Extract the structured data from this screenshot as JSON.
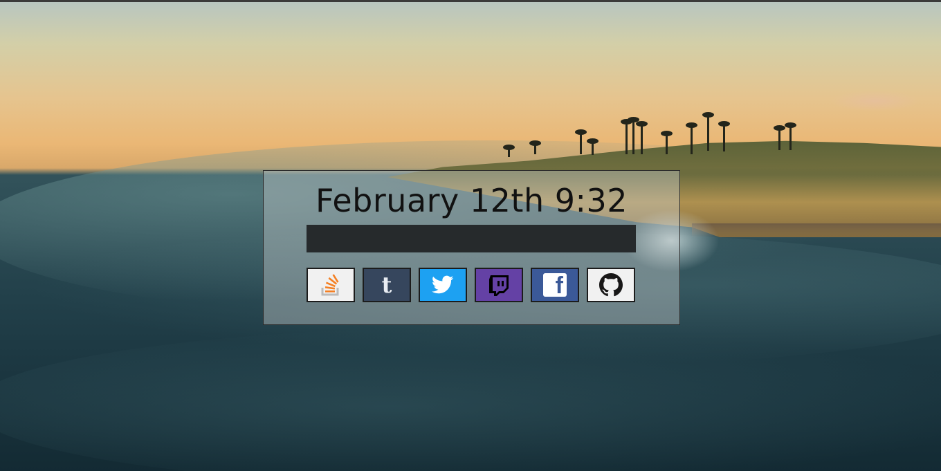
{
  "clock": {
    "text": "February 12th 9:32"
  },
  "search": {
    "value": "",
    "placeholder": ""
  },
  "links": [
    {
      "name": "stackoverflow",
      "icon": "stackoverflow-icon",
      "bg": "#f1f1f1"
    },
    {
      "name": "tumblr",
      "icon": "tumblr-icon",
      "bg": "#36465d",
      "glyph": "t"
    },
    {
      "name": "twitter",
      "icon": "twitter-icon",
      "bg": "#1da1f2"
    },
    {
      "name": "twitch",
      "icon": "twitch-icon",
      "bg": "#6441a5"
    },
    {
      "name": "facebook",
      "icon": "facebook-icon",
      "bg": "#3b5998",
      "glyph": "f"
    },
    {
      "name": "github",
      "icon": "github-icon",
      "bg": "#f1f1f1"
    }
  ],
  "colors": {
    "card_bg": "rgba(200,205,205,0.42)",
    "search_bg": "#262a2c",
    "stackoverflow": "#f48024",
    "tumblr": "#36465d",
    "twitter": "#1da1f2",
    "twitch": "#6441a5",
    "facebook": "#3b5998",
    "github": "#181717"
  }
}
